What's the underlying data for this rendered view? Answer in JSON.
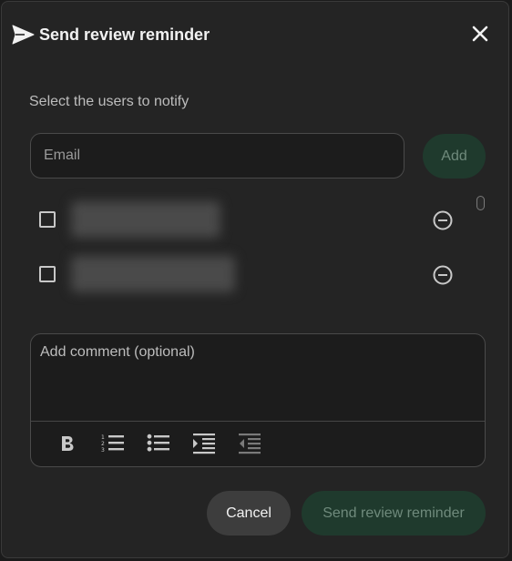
{
  "dialog": {
    "title": "Send review reminder",
    "subtitle": "Select the users to notify",
    "close_icon": "close-icon",
    "title_icon": "send-icon"
  },
  "email": {
    "placeholder": "Email",
    "value": "",
    "add_label": "Add"
  },
  "users": [
    {
      "checked": false,
      "name_redacted": true,
      "remove_icon": "remove-circle-icon"
    },
    {
      "checked": false,
      "name_redacted": true,
      "remove_icon": "remove-circle-icon"
    }
  ],
  "comment": {
    "placeholder": "Add comment (optional)",
    "value": ""
  },
  "toolbar": {
    "tools": [
      "bold-icon",
      "numbered-list-icon",
      "bulleted-list-icon",
      "indent-icon",
      "outdent-icon"
    ]
  },
  "footer": {
    "cancel_label": "Cancel",
    "send_label": "Send review reminder"
  },
  "colors": {
    "background": "#242424",
    "accent_disabled_bg": "#1f3a2d",
    "accent_disabled_text": "#6f8a7c"
  }
}
